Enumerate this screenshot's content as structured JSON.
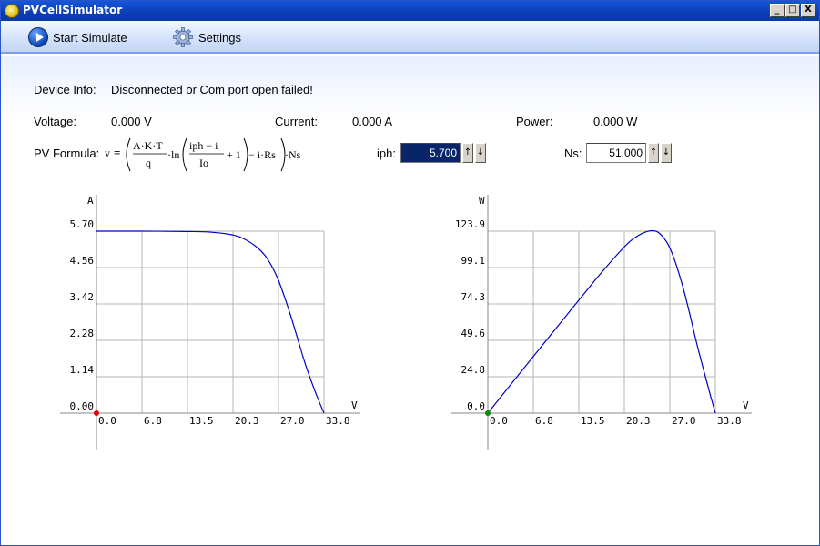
{
  "window": {
    "title": "PVCellSimulator",
    "minimize": "_",
    "maximize": "□",
    "close": "X"
  },
  "toolbar": {
    "start_label": "Start Simulate",
    "settings_label": "Settings"
  },
  "device": {
    "label": "Device Info:",
    "status": "Disconnected or Com port open failed!"
  },
  "readings": {
    "voltage_label": "Voltage:",
    "voltage_value": "0.000 V",
    "current_label": "Current:",
    "current_value": "0.000 A",
    "power_label": "Power:",
    "power_value": "0.000 W"
  },
  "formula": {
    "label": "PV Formula:",
    "v": "v",
    "eq": "=",
    "num1": "A·K·T",
    "den1": "q",
    "ln": "·ln",
    "num2": "iph − i",
    "den2": "Io",
    "plus": "+ 1",
    "minus_rs": "− i·Rs",
    "ns": "·Ns"
  },
  "iph": {
    "label": "iph:",
    "value": "5.700",
    "up": "↑",
    "down": "↓"
  },
  "ns": {
    "label": "Ns:",
    "value": "51.000",
    "up": "↑",
    "down": "↓"
  },
  "colors": {
    "curve": "#0000c8",
    "grid": "#b4b4b4",
    "marker_iv": "#e00000",
    "marker_pv": "#0a8a0a"
  },
  "chart_data": [
    {
      "type": "line",
      "xlabel": "V",
      "ylabel": "A",
      "x_ticks": [
        "0.0",
        "6.8",
        "13.5",
        "20.3",
        "27.0",
        "33.8"
      ],
      "y_ticks": [
        "0.00",
        "1.14",
        "2.28",
        "3.42",
        "4.56",
        "5.70"
      ],
      "xlim": [
        0,
        33.8
      ],
      "ylim": [
        0,
        5.7
      ],
      "grid": true,
      "marker": {
        "x": 0,
        "y": 0
      },
      "series": [
        {
          "x": [
            0,
            6.8,
            13.5,
            16.9,
            20.3,
            22.0,
            23.7,
            25.0,
            26.0,
            27.0,
            28.0,
            29.0,
            30.0,
            31.0,
            32.0,
            33.0,
            33.8
          ],
          "values": [
            5.7,
            5.7,
            5.69,
            5.67,
            5.58,
            5.45,
            5.22,
            4.95,
            4.62,
            4.18,
            3.6,
            2.95,
            2.25,
            1.55,
            0.95,
            0.4,
            0.0
          ]
        }
      ]
    },
    {
      "type": "line",
      "xlabel": "V",
      "ylabel": "W",
      "x_ticks": [
        "0.0",
        "6.8",
        "13.5",
        "20.3",
        "27.0",
        "33.8"
      ],
      "y_ticks": [
        "0.0",
        "24.8",
        "49.6",
        "74.3",
        "99.1",
        "123.9"
      ],
      "xlim": [
        0,
        33.8
      ],
      "ylim": [
        0,
        123.9
      ],
      "grid": true,
      "marker": {
        "x": 0,
        "y": 0
      },
      "series": [
        {
          "x": [
            0,
            6.8,
            13.5,
            16.9,
            20.3,
            22.0,
            23.7,
            25.0,
            26.0,
            27.0,
            28.0,
            29.0,
            30.0,
            31.0,
            32.0,
            33.0,
            33.8
          ],
          "values": [
            0,
            38.8,
            76.8,
            95.8,
            113.3,
            119.9,
            123.7,
            123.8,
            120.1,
            112.9,
            100.8,
            85.6,
            67.5,
            48.1,
            30.4,
            13.2,
            0.0
          ]
        }
      ]
    }
  ]
}
